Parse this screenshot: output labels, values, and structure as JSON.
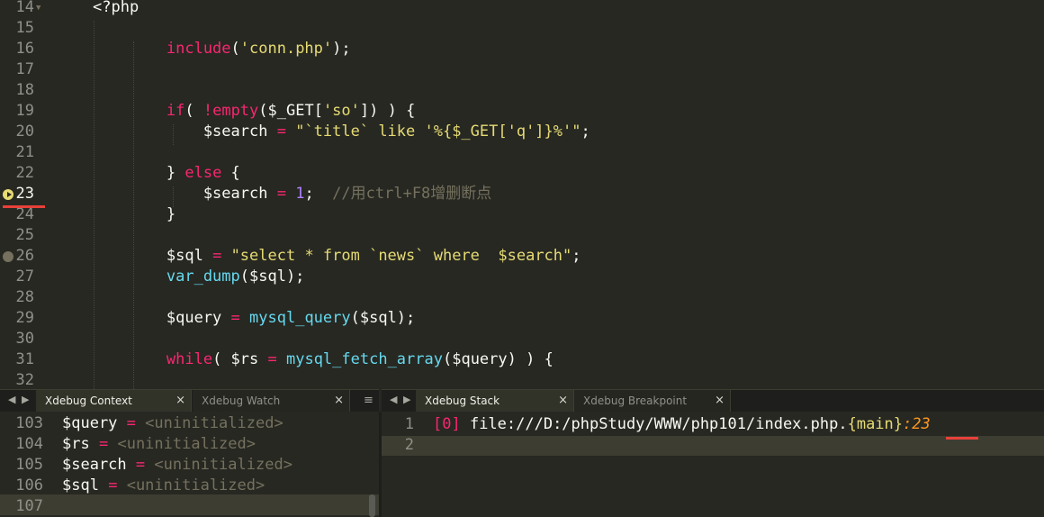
{
  "editor": {
    "lines": [
      {
        "n": "14",
        "tokens": [
          {
            "t": "<?php",
            "c": ""
          }
        ]
      },
      {
        "n": "15",
        "tokens": []
      },
      {
        "n": "16",
        "tokens": [
          {
            "t": "        include",
            "c": "kw"
          },
          {
            "t": "(",
            "c": ""
          },
          {
            "t": "'conn.php'",
            "c": "st"
          },
          {
            "t": ");",
            "c": ""
          }
        ]
      },
      {
        "n": "17",
        "tokens": []
      },
      {
        "n": "18",
        "tokens": []
      },
      {
        "n": "19",
        "tokens": [
          {
            "t": "        if",
            "c": "kw"
          },
          {
            "t": "( ",
            "c": ""
          },
          {
            "t": "!",
            "c": "op"
          },
          {
            "t": "empty",
            "c": "kw"
          },
          {
            "t": "($_GET[",
            "c": ""
          },
          {
            "t": "'so'",
            "c": "st"
          },
          {
            "t": "]) ) {",
            "c": ""
          }
        ]
      },
      {
        "n": "20",
        "tokens": [
          {
            "t": "            $search ",
            "c": ""
          },
          {
            "t": "=",
            "c": "op"
          },
          {
            "t": " ",
            "c": ""
          },
          {
            "t": "\"`title` like '%{$_GET['q']}%'\"",
            "c": "st"
          },
          {
            "t": ";",
            "c": ""
          }
        ]
      },
      {
        "n": "21",
        "tokens": []
      },
      {
        "n": "22",
        "tokens": [
          {
            "t": "        } ",
            "c": ""
          },
          {
            "t": "else",
            "c": "kw"
          },
          {
            "t": " {",
            "c": ""
          }
        ]
      },
      {
        "n": "23",
        "tokens": [
          {
            "t": "            $search ",
            "c": ""
          },
          {
            "t": "=",
            "c": "op"
          },
          {
            "t": " ",
            "c": ""
          },
          {
            "t": "1",
            "c": "nu"
          },
          {
            "t": ";  ",
            "c": ""
          },
          {
            "t": "//用ctrl+F8增删断点",
            "c": "cm"
          }
        ]
      },
      {
        "n": "24",
        "tokens": [
          {
            "t": "        }",
            "c": ""
          }
        ]
      },
      {
        "n": "25",
        "tokens": []
      },
      {
        "n": "26",
        "tokens": [
          {
            "t": "        $sql ",
            "c": ""
          },
          {
            "t": "=",
            "c": "op"
          },
          {
            "t": " ",
            "c": ""
          },
          {
            "t": "\"select * from `news` where  $search\"",
            "c": "st"
          },
          {
            "t": ";",
            "c": ""
          }
        ]
      },
      {
        "n": "27",
        "tokens": [
          {
            "t": "        var_dump",
            "c": "fn"
          },
          {
            "t": "($sql);",
            "c": ""
          }
        ]
      },
      {
        "n": "28",
        "tokens": []
      },
      {
        "n": "29",
        "tokens": [
          {
            "t": "        $query ",
            "c": ""
          },
          {
            "t": "=",
            "c": "op"
          },
          {
            "t": " ",
            "c": ""
          },
          {
            "t": "mysql_query",
            "c": "fn"
          },
          {
            "t": "($sql);",
            "c": ""
          }
        ]
      },
      {
        "n": "30",
        "tokens": []
      },
      {
        "n": "31",
        "tokens": [
          {
            "t": "        while",
            "c": "kw"
          },
          {
            "t": "( $rs ",
            "c": ""
          },
          {
            "t": "=",
            "c": "op"
          },
          {
            "t": " ",
            "c": ""
          },
          {
            "t": "mysql_fetch_array",
            "c": "fn"
          },
          {
            "t": "($query) ) {",
            "c": ""
          }
        ]
      },
      {
        "n": "32",
        "tokens": []
      }
    ],
    "current_line": "23",
    "breakpoints": [
      "23",
      "26"
    ]
  },
  "left_panel": {
    "nav_left": "◀",
    "nav_right": "▶",
    "tabs": [
      {
        "label": "Xdebug Context",
        "close": "×"
      },
      {
        "label": "Xdebug Watch",
        "close": "×"
      }
    ],
    "menu_icon": "≡",
    "rows": [
      {
        "n": "103",
        "var": "$query",
        "eq": "=",
        "val": "<uninitialized>"
      },
      {
        "n": "104",
        "var": "$rs",
        "eq": "=",
        "val": "<uninitialized>"
      },
      {
        "n": "105",
        "var": "$search",
        "eq": "=",
        "val": "<uninitialized>"
      },
      {
        "n": "106",
        "var": "$sql",
        "eq": "=",
        "val": "<uninitialized>"
      },
      {
        "n": "107",
        "var": "",
        "eq": "",
        "val": ""
      }
    ]
  },
  "right_panel": {
    "nav_left": "◀",
    "nav_right": "▶",
    "tabs": [
      {
        "label": "Xdebug Stack",
        "close": "×"
      },
      {
        "label": "Xdebug Breakpoint",
        "close": "×"
      }
    ],
    "rows": [
      {
        "n": "1",
        "idx": "[0]",
        "path": " file:///D:/phpStudy/WWW/php101/index.php.",
        "scope": "{main}",
        "line": ":23"
      },
      {
        "n": "2",
        "idx": "",
        "path": "",
        "scope": "",
        "line": ""
      }
    ]
  },
  "colors": {
    "keyword": "#f92672",
    "function": "#66d9ef",
    "string": "#e6db74",
    "comment": "#75715e",
    "number": "#ae81ff",
    "highlight": "#e8403a"
  }
}
